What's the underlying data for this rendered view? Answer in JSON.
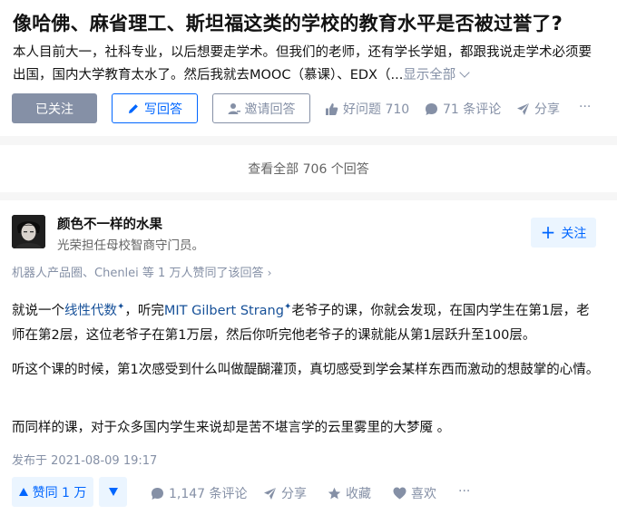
{
  "question": {
    "title": "像哈佛、麻省理工、斯坦福这类的学校的教育水平是否被过誉了?",
    "detail_line1": "本人目前大一，社科专业，以后想要走学术。但我们的老师，还有学长学姐，都跟我说走学术必须要",
    "detail_line2": "出国，国内大学教育太水了。然后我就去MOOC（慕课）、EDX（...",
    "show_all": "显示全部",
    "buttons": {
      "followed": "已关注",
      "write": "写回答",
      "invite": "邀请回答"
    },
    "actions": {
      "good_question": "好问题 710",
      "comments": "71 条评论",
      "share": "分享",
      "more": "···"
    }
  },
  "view_all": "查看全部 706 个回答",
  "answer": {
    "author": {
      "name": "颜色不一样的水果",
      "bio": "光荣担任母校智商守门员。",
      "follow": "关注"
    },
    "voters": "机器人产品圈、Chenlei 等 1 万人赞同了该回答",
    "p1_a": "就说一个",
    "p1_link1": "线性代数",
    "p1_b": "，听完",
    "p1_link2": "MIT Gilbert Strang",
    "p1_c": "老爷子的课，你就会发现，在国内学生在第1层，老师在第2层，这位老爷子在第1万层，然后你听完他老爷子的课就能从第1层跃升至100层。",
    "p2": "听这个课的时候，第1次感受到什么叫做醍醐灌顶，真切感受到学会某样东西而激动的想鼓掌的心情。",
    "p3": "而同样的课，对于众多国内学生来说却是苦不堪言学的云里雾里的大梦魇 。",
    "publish_time": "发布于 2021-08-09 19:17",
    "actions": {
      "upvote": "赞同 1 万",
      "comments": "1,147 条评论",
      "share": "分享",
      "collect": "收藏",
      "like": "喜欢",
      "more": "···"
    }
  },
  "colors": {
    "accent": "#0066ff",
    "muted": "#8590a6",
    "link": "#175199",
    "accent_bg": "#ebf5ff"
  }
}
